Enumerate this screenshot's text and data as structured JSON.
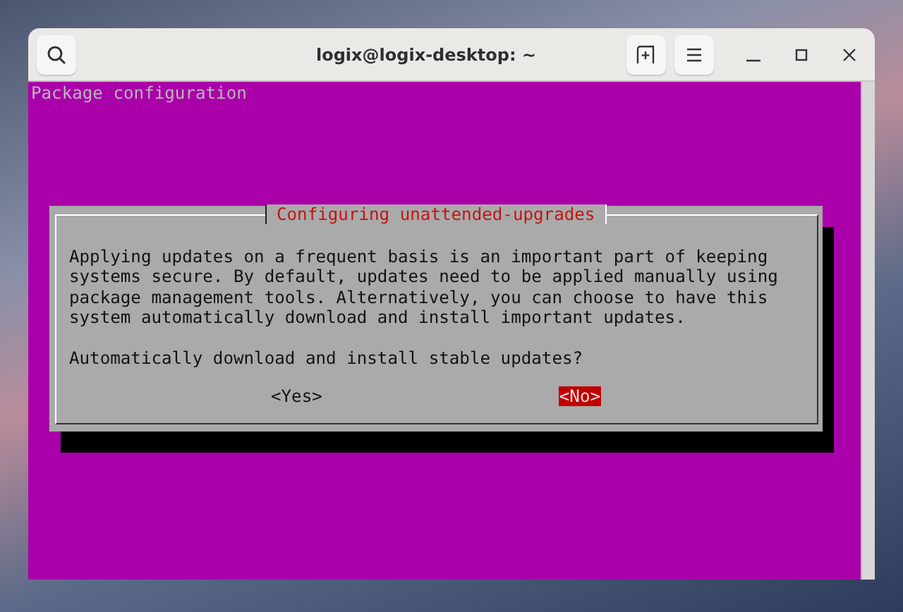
{
  "window": {
    "title": "logix@logix-desktop: ~"
  },
  "terminal": {
    "header": "Package configuration",
    "dialog": {
      "title": "Configuring unattended-upgrades",
      "message": "Applying updates on a frequent basis is an important part of keeping\nsystems secure. By default, updates need to be applied manually using\npackage management tools. Alternatively, you can choose to have this\nsystem automatically download and install important updates.",
      "question": "Automatically download and install stable updates?",
      "buttons": [
        {
          "label": "<Yes>",
          "selected": false
        },
        {
          "label": "<No>",
          "selected": true
        }
      ]
    }
  }
}
